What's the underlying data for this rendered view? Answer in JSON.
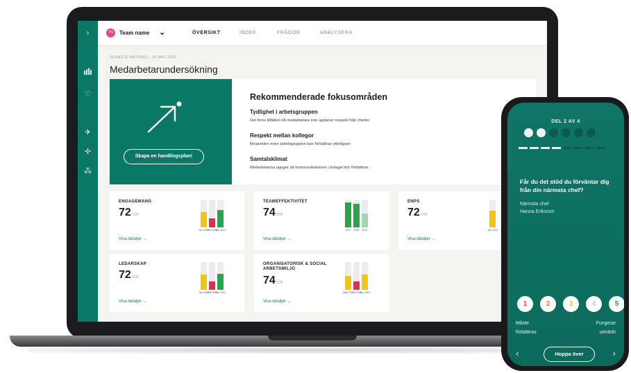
{
  "top_nav": {
    "team_name": "Team name",
    "team_avatar_text": "TN",
    "tabs": [
      {
        "label": "ÖVERSIKT",
        "active": true
      },
      {
        "label": "INDEX",
        "active": false
      },
      {
        "label": "FRÅGOR",
        "active": false
      },
      {
        "label": "ANALYSERA",
        "active": false
      }
    ]
  },
  "sidebar": {
    "icons": [
      "chevron-right-icon",
      "bar-chart-icon",
      "heart-icon",
      "plane-icon",
      "airplane-icon",
      "org-chart-icon"
    ]
  },
  "header": {
    "eyebrow": "SENASTE MÄTNING · 25 MAJ 2022",
    "title": "Medarbetarundersökning"
  },
  "focus": {
    "action_button": "Skapa en handlingsplan!",
    "title": "Rekommenderade fokusområden",
    "items": [
      {
        "heading": "Tydlighet i arbetsgruppen",
        "text": "Det finns tillfällen då medarbetare inte upplever respekt från chefen"
      },
      {
        "heading": "Respekt mellan kollegor",
        "text": "Respekten inom arbetsgruppen kan förbättras ytterligare"
      },
      {
        "heading": "Samtalsklimat",
        "text": "Medarbetarna uppger att kommunikationen i bolaget bör förbättras."
      }
    ]
  },
  "cards": [
    {
      "label": "ENGAGEMANG",
      "score": "72",
      "suffix": "/100",
      "link": "Visa detaljer →",
      "bars": [
        {
          "label": "Jan 2019",
          "fraction": 0.55,
          "color": "#f0c419"
        },
        {
          "label": "Feb 2020",
          "fraction": 0.32,
          "color": "#e0304a"
        },
        {
          "label": "Mar 2021",
          "fraction": 0.62,
          "color": "#2aa34a"
        }
      ]
    },
    {
      "label": "TEAMEFFEKTIVITET",
      "score": "74",
      "suffix": "/100",
      "link": "Visa detaljer →",
      "bars": [
        {
          "label": "2017",
          "fraction": 0.9,
          "color": "#2aa34a"
        },
        {
          "label": "2018",
          "fraction": 0.85,
          "color": "#2aa34a"
        },
        {
          "label": "2019",
          "fraction": 0.5,
          "color": "#9fd8b0"
        }
      ]
    },
    {
      "label": "ENPS",
      "score": "72",
      "suffix": "/100",
      "link": "Visa detaljer →",
      "bars": [
        {
          "label": "Jan 2019",
          "fraction": 0.6,
          "color": "#f0c419"
        }
      ]
    },
    {
      "label": "LEDARSKAP",
      "score": "72",
      "suffix": "/100",
      "link": "Visa detaljer →",
      "bars": [
        {
          "label": "Jan 2019",
          "fraction": 0.55,
          "color": "#f0c419"
        },
        {
          "label": "Feb 2020",
          "fraction": 0.3,
          "color": "#e0304a"
        },
        {
          "label": "Mar 2021",
          "fraction": 0.58,
          "color": "#2aa34a"
        }
      ]
    },
    {
      "label": "ORGANISATORISK & SOCIAL ARBETSMILJÖ",
      "score": "74",
      "suffix": "/100",
      "link": "Visa detaljer →",
      "bars": [
        {
          "label": "May 2017",
          "fraction": 0.5,
          "color": "#f0c419"
        },
        {
          "label": "Apr 2018",
          "fraction": 0.3,
          "color": "#e0304a"
        },
        {
          "label": "Apr 2019",
          "fraction": 0.55,
          "color": "#f0c419"
        }
      ]
    }
  ],
  "phone": {
    "step": "DEL 2 AV 4",
    "question": "Får du det stöd du förväntar dig från din närmsta chef?",
    "meta_label": "Närmsta chef",
    "meta_name": "Hanna Eriksson",
    "scale": [
      {
        "n": "1",
        "color": "#e04b3a"
      },
      {
        "n": "2",
        "color": "#f07a22"
      },
      {
        "n": "3",
        "color": "#f2c418"
      },
      {
        "n": "4",
        "color": "#b9c5c1"
      },
      {
        "n": "5",
        "color": "#2aa34a"
      }
    ],
    "low_label_1": "Måste",
    "low_label_2": "förbättras",
    "high_label_1": "Fungerar",
    "high_label_2": "utmärkt",
    "skip": "Hoppa över"
  }
}
